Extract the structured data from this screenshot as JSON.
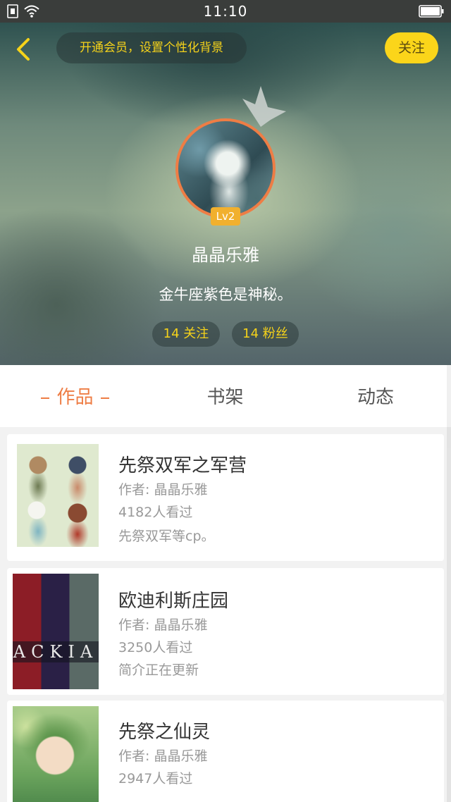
{
  "status_bar": {
    "time": "11:10",
    "icons": [
      "sim-icon",
      "wifi-icon",
      "battery-icon"
    ]
  },
  "header": {
    "back_icon": "chevron-left-icon",
    "vip_banner": "开通会员，设置个性化背景",
    "follow_label": "关注",
    "level": "Lv2",
    "username": "晶晶乐雅",
    "bio": "金牛座紫色是神秘。",
    "following": "14 关注",
    "followers": "14 粉丝"
  },
  "tabs": [
    {
      "label": "作品",
      "active": true
    },
    {
      "label": "书架",
      "active": false
    },
    {
      "label": "动态",
      "active": false
    }
  ],
  "works": [
    {
      "title": "先祭双军之军营",
      "author": "作者: 晶晶乐雅",
      "views": "4182人看过",
      "intro": "先祭双军等cp。"
    },
    {
      "title": "欧迪利斯庄园",
      "author": "作者: 晶晶乐雅",
      "views": "3250人看过",
      "intro": "简介正在更新",
      "cover_text": "ACKIA"
    },
    {
      "title": "先祭之仙灵",
      "author": "作者: 晶晶乐雅",
      "views": "2947人看过",
      "intro": ""
    }
  ],
  "colors": {
    "accent": "#ee7d45",
    "yellow": "#fbd51a",
    "badge": "#f1b02e"
  }
}
